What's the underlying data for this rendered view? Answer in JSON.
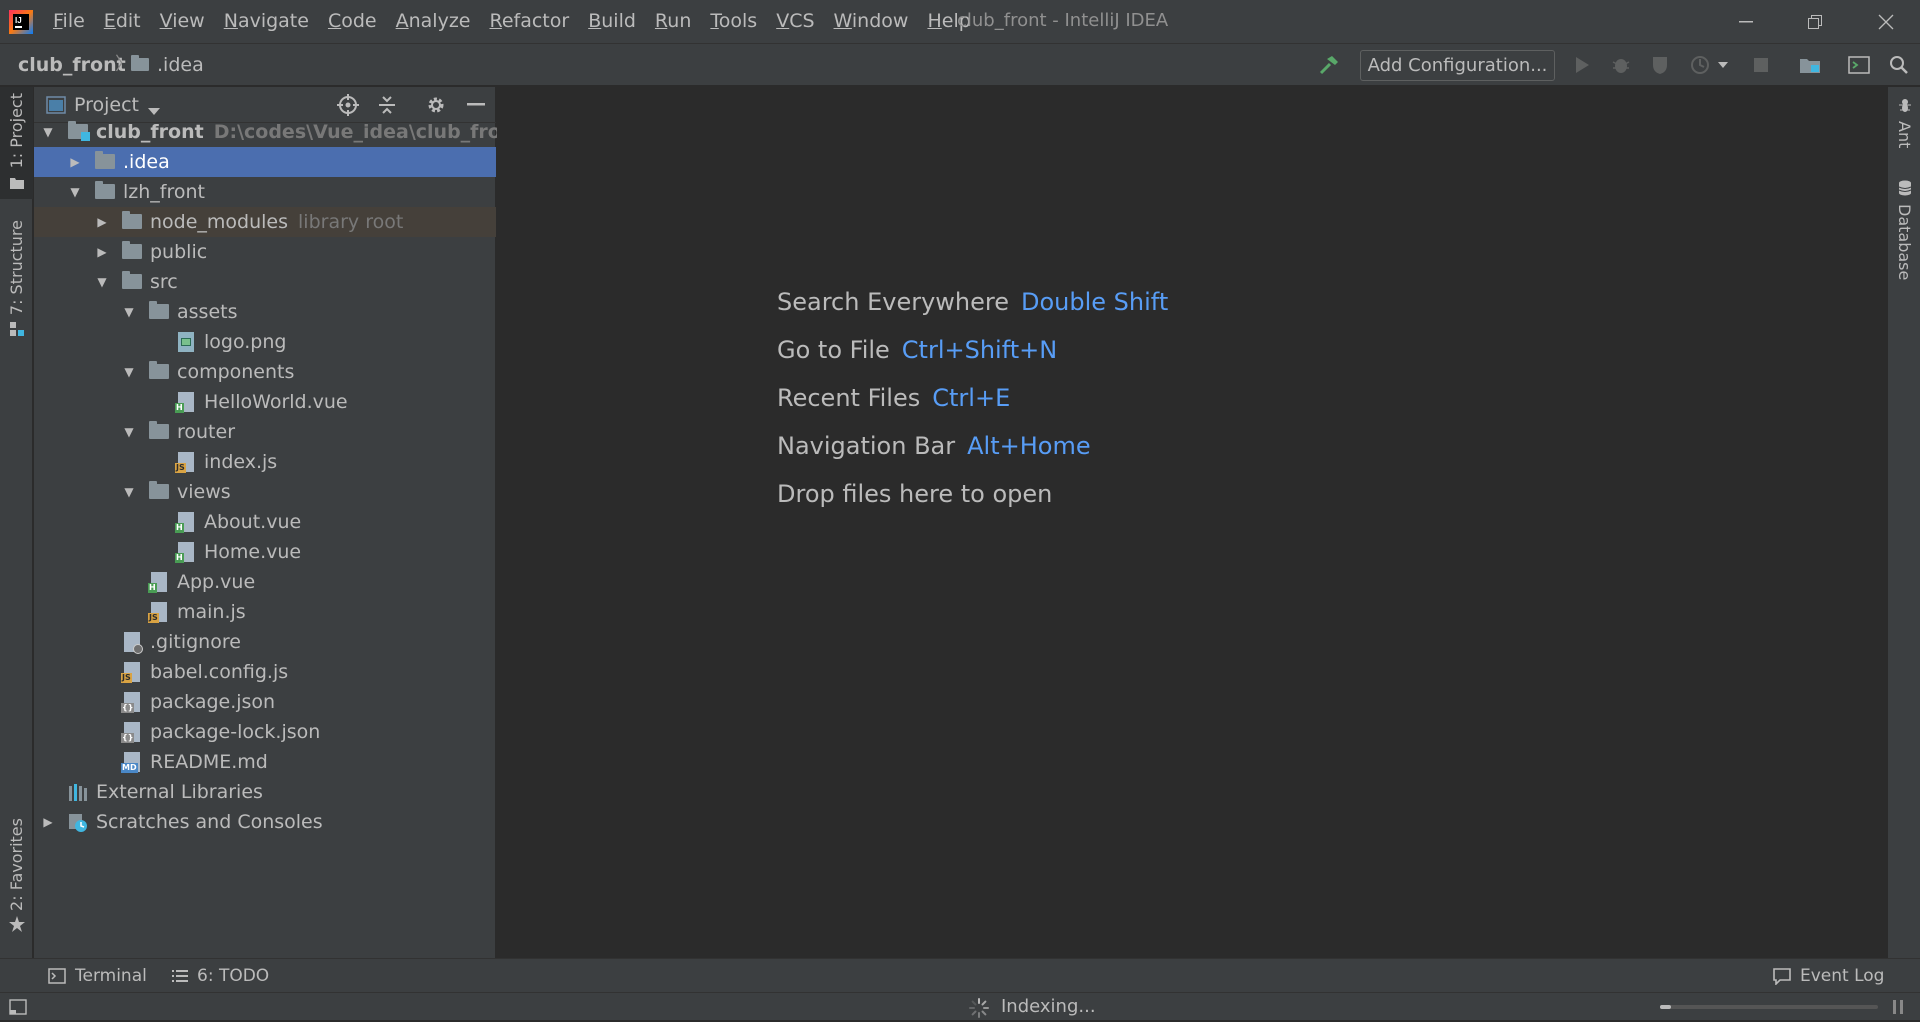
{
  "titlebar": {
    "menu": [
      "File",
      "Edit",
      "View",
      "Navigate",
      "Code",
      "Analyze",
      "Refactor",
      "Build",
      "Run",
      "Tools",
      "VCS",
      "Window",
      "Help"
    ],
    "window_title": "club_front - IntelliJ IDEA"
  },
  "navbar": {
    "breadcrumb_root": "club_front",
    "breadcrumb_sep": "〉",
    "breadcrumb_item": ".idea",
    "add_configuration": "Add Configuration..."
  },
  "left_strip": {
    "project_tab": "1: Project",
    "structure_tab": "7: Structure",
    "favorites_tab": "2: Favorites"
  },
  "right_strip": {
    "ant_tab": "Ant",
    "database_tab": "Database"
  },
  "project_panel": {
    "title": "Project",
    "tree": [
      {
        "label": "club_front",
        "hint": "D:\\codes\\Vue_idea\\club_front",
        "icon": "module-folder-icon",
        "arrow": "down"
      },
      {
        "label": ".idea",
        "icon": "folder-icon",
        "arrow": "right",
        "selected": true
      },
      {
        "label": "lzh_front",
        "icon": "folder-icon",
        "arrow": "down"
      },
      {
        "label": "node_modules",
        "hint": "library root",
        "icon": "folder-icon",
        "arrow": "right",
        "library": true
      },
      {
        "label": "public",
        "icon": "folder-icon",
        "arrow": "right"
      },
      {
        "label": "src",
        "icon": "folder-icon",
        "arrow": "down"
      },
      {
        "label": "assets",
        "icon": "folder-icon",
        "arrow": "down"
      },
      {
        "label": "logo.png",
        "icon": "image-file-icon"
      },
      {
        "label": "components",
        "icon": "folder-icon",
        "arrow": "down"
      },
      {
        "label": "HelloWorld.vue",
        "icon": "vue-file-icon"
      },
      {
        "label": "router",
        "icon": "folder-icon",
        "arrow": "down"
      },
      {
        "label": "index.js",
        "icon": "js-file-icon"
      },
      {
        "label": "views",
        "icon": "folder-icon",
        "arrow": "down"
      },
      {
        "label": "About.vue",
        "icon": "vue-file-icon"
      },
      {
        "label": "Home.vue",
        "icon": "vue-file-icon"
      },
      {
        "label": "App.vue",
        "icon": "vue-file-icon"
      },
      {
        "label": "main.js",
        "icon": "js-file-icon"
      },
      {
        "label": ".gitignore",
        "icon": "ignore-file-icon"
      },
      {
        "label": "babel.config.js",
        "icon": "js-file-icon"
      },
      {
        "label": "package.json",
        "icon": "json-file-icon"
      },
      {
        "label": "package-lock.json",
        "icon": "json-file-icon"
      },
      {
        "label": "README.md",
        "icon": "markdown-file-icon"
      },
      {
        "label": "External Libraries",
        "icon": "libraries-icon"
      },
      {
        "label": "Scratches and Consoles",
        "icon": "scratches-icon",
        "arrow": "right"
      }
    ]
  },
  "editor": {
    "hints": [
      {
        "label": "Search Everywhere",
        "shortcut": "Double Shift"
      },
      {
        "label": "Go to File",
        "shortcut": "Ctrl+Shift+N"
      },
      {
        "label": "Recent Files",
        "shortcut": "Ctrl+E"
      },
      {
        "label": "Navigation Bar",
        "shortcut": "Alt+Home"
      },
      {
        "label": "Drop files here to open",
        "shortcut": ""
      }
    ]
  },
  "tool_bar": {
    "terminal": "Terminal",
    "todo": "6: TODO",
    "event_log": "Event Log"
  },
  "status_bar": {
    "status": "Indexing...",
    "progress": 0.05
  },
  "colors": {
    "accent_blue": "#589df6",
    "selection": "#4b6eaf",
    "vue_green": "#499c54",
    "js_yellow": "#d9a343"
  }
}
